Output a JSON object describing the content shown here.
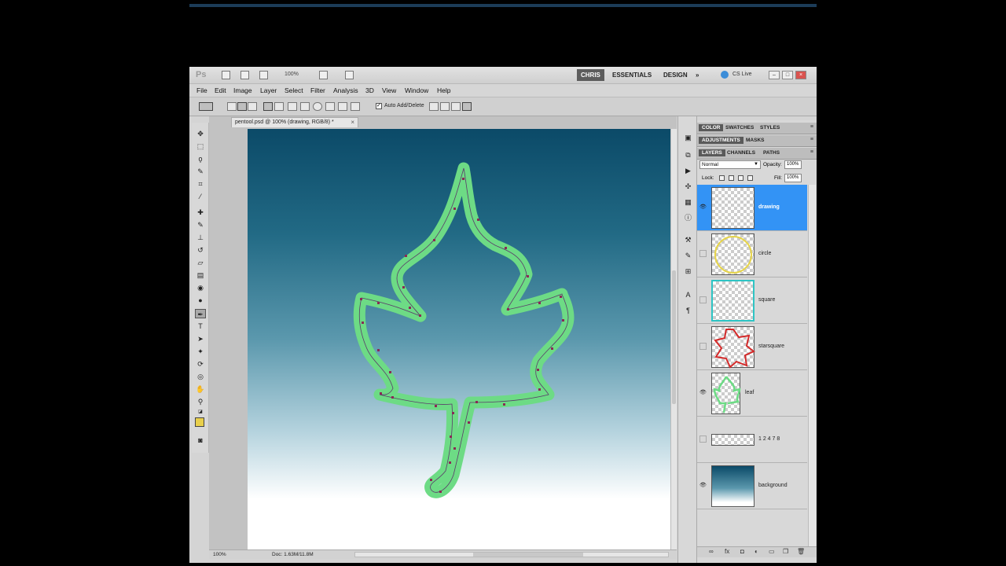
{
  "app": {
    "logo": "Ps",
    "zoom": "100%",
    "workspaces": [
      "CHRIS",
      "ESSENTIALS",
      "DESIGN"
    ],
    "more": "»",
    "cslive": "CS Live"
  },
  "menu": [
    "File",
    "Edit",
    "Image",
    "Layer",
    "Select",
    "Filter",
    "Analysis",
    "3D",
    "View",
    "Window",
    "Help"
  ],
  "options": {
    "auto_add_delete_label": "Auto Add/Delete",
    "auto_add_delete_checked": true
  },
  "document": {
    "tab_title": "pentool.psd @ 100% (drawing, RGB/8) *",
    "close": "×"
  },
  "status": {
    "zoom": "100%",
    "doc": "Doc: 1.63M/11.8M"
  },
  "colors": {
    "foreground": "#e8cf4b",
    "background": "#ffffff",
    "path_stroke": "#6ddb85",
    "selection": "#3393f5"
  },
  "panels": {
    "row1": [
      "COLOR",
      "SWATCHES",
      "STYLES"
    ],
    "row2": [
      "ADJUSTMENTS",
      "MASKS"
    ],
    "row3": [
      "LAYERS",
      "CHANNELS",
      "PATHS"
    ],
    "blend_mode": "Normal",
    "opacity_label": "Opacity:",
    "opacity": "100%",
    "lock_label": "Lock:",
    "fill_label": "Fill:",
    "fill": "100%"
  },
  "layers": [
    {
      "name": "drawing",
      "visible": true,
      "selected": true
    },
    {
      "name": "circle",
      "visible": false,
      "selected": false
    },
    {
      "name": "square",
      "visible": false,
      "selected": false
    },
    {
      "name": "starsquare",
      "visible": false,
      "selected": false
    },
    {
      "name": "leaf",
      "visible": true,
      "selected": false
    },
    {
      "name": "1 2 4 7 8",
      "visible": false,
      "selected": false
    },
    {
      "name": "background",
      "visible": true,
      "selected": false
    }
  ]
}
